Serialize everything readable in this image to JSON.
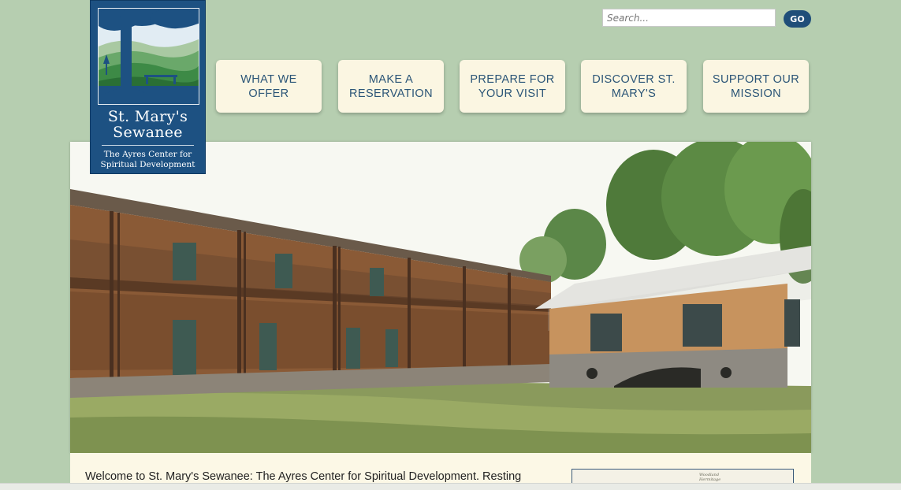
{
  "site": {
    "logo": {
      "title_line1": "St. Mary's",
      "title_line2": "Sewanee",
      "subtitle_line1": "The Ayres Center for",
      "subtitle_line2": "Spiritual Development"
    }
  },
  "search": {
    "placeholder": "Search...",
    "go_label": "GO"
  },
  "nav": {
    "items": [
      {
        "label": "WHAT WE OFFER"
      },
      {
        "label": "MAKE A RESERVATION"
      },
      {
        "label": "PREPARE FOR YOUR VISIT"
      },
      {
        "label": "DISCOVER ST. MARY'S"
      },
      {
        "label": "SUPPORT OUR MISSION"
      }
    ]
  },
  "content": {
    "welcome_text": "Welcome to St. Mary's Sewanee: The Ayres Center for Spiritual Development. Resting",
    "map_thumb_label": "Woodland Hermitage"
  },
  "colors": {
    "background": "#b6ceb0",
    "logo_blue": "#1d5182",
    "nav_bg": "#fbf6e2",
    "nav_text": "#2b5577",
    "go_button": "#1f4e79"
  }
}
